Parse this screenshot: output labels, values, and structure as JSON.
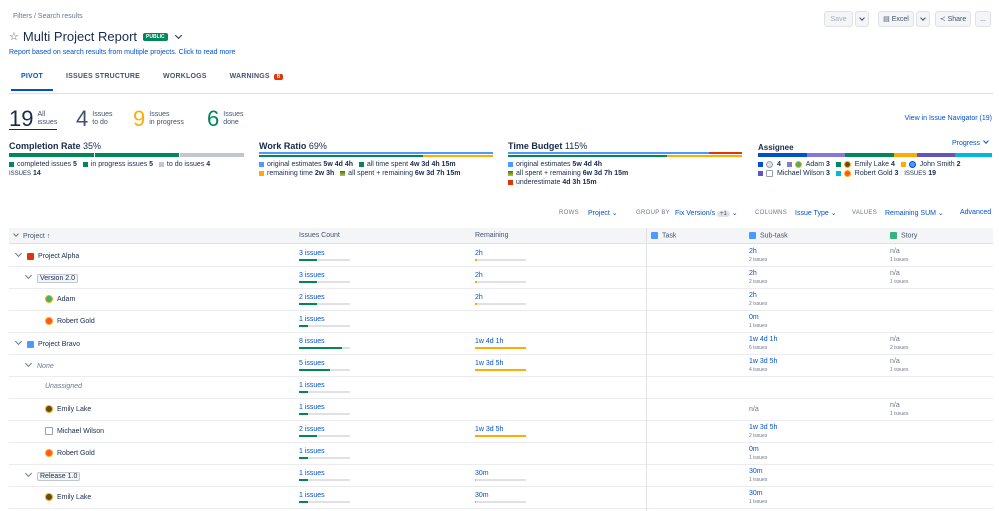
{
  "breadcrumb": {
    "part1": "Filters",
    "part2": "/ Search results"
  },
  "title": "Multi Project Report",
  "visibility_badge": "PUBLIC",
  "description_link": "Report based on search results from multiple projects. Click to read more",
  "toolbar": {
    "save": "Save",
    "excel": "Excel",
    "share": "Share",
    "more": "..."
  },
  "tabs": [
    {
      "label": "PIVOT"
    },
    {
      "label": "ISSUES STRUCTURE"
    },
    {
      "label": "WORKLOGS"
    },
    {
      "label": "WARNINGS"
    }
  ],
  "warnings_count": "6",
  "stats": [
    {
      "num": "19",
      "l1": "All",
      "l2": "issues",
      "color": "#172b4d"
    },
    {
      "num": "4",
      "l1": "Issues",
      "l2": "to do",
      "color": "#42526e"
    },
    {
      "num": "9",
      "l1": "Issues",
      "l2": "in progress",
      "color": "#ffab00"
    },
    {
      "num": "6",
      "l1": "Issues",
      "l2": "done",
      "color": "#00875a"
    }
  ],
  "view_navigator": "View in Issue Navigator (19)",
  "completion": {
    "title": "Completion Rate",
    "pct": "35%",
    "completed": "completed issues",
    "completed_n": "5",
    "inprogress": "in progress issues",
    "inprogress_n": "5",
    "todo": "to do issues",
    "todo_n": "4",
    "issues_label": "ISSUES",
    "issues_n": "14"
  },
  "work_ratio": {
    "title": "Work Ratio",
    "pct": "69%",
    "orig": "original estimates",
    "orig_v": "5w 4d 4h",
    "spent": "all time spent",
    "spent_v": "4w 3d 4h 15m",
    "remain": "remaining time",
    "remain_v": "2w 3h",
    "spent_rem": "all spent + remaining",
    "spent_rem_v": "6w 3d 7h 15m"
  },
  "time_budget": {
    "title": "Time Budget",
    "pct": "115%",
    "orig": "original estimates",
    "orig_v": "5w 4d 4h",
    "spent_rem": "all spent + remaining",
    "spent_rem_v": "6w 3d 7h 15m",
    "under": "underestimate",
    "under_v": "4d 3h 15m"
  },
  "assignee": {
    "title": "Assignee",
    "progress": "Progress",
    "a1_n": "4",
    "a2": "Adam",
    "a2_n": "3",
    "a3": "Emily Lake",
    "a3_n": "4",
    "a4": "John Smith",
    "a4_n": "2",
    "a5": "Michael Wilson",
    "a5_n": "3",
    "a6": "Robert Gold",
    "a6_n": "3",
    "issues_label": "ISSUES",
    "issues_n": "19"
  },
  "controls": {
    "rows": "ROWS",
    "rows_v": "Project",
    "group": "GROUP BY",
    "group_v": "Fix Version/s",
    "group_extra": "+1",
    "columns": "COLUMNS",
    "columns_v": "Issue Type",
    "values": "VALUES",
    "values_v": "Remaining SUM",
    "advanced": "Advanced"
  },
  "headers": {
    "project": "Project",
    "count": "Issues Count",
    "remaining": "Remaining",
    "task": "Task",
    "subtask": "Sub-task",
    "story": "Story"
  },
  "rows": [
    {
      "name": "Project Alpha",
      "count": "3 issues",
      "rem": "2h",
      "sub": "2h",
      "sub2": "2 issues",
      "story": "n/a",
      "story2": "1 issues"
    },
    {
      "name": "Version 2.0",
      "count": "3 issues",
      "rem": "2h",
      "sub": "2h",
      "sub2": "2 issues",
      "story": "n/a",
      "story2": "1 issues"
    },
    {
      "name": "Adam",
      "count": "2 issues",
      "rem": "2h",
      "sub": "2h",
      "sub2": "2 issues",
      "story": "",
      "story2": ""
    },
    {
      "name": "Robert Gold",
      "count": "1 issues",
      "rem": "",
      "sub": "0m",
      "sub2": "1 issues",
      "story": "",
      "story2": ""
    },
    {
      "name": "Project Bravo",
      "count": "8 issues",
      "rem": "1w 4d 1h",
      "sub": "1w 4d 1h",
      "sub2": "6 issues",
      "story": "n/a",
      "story2": "2 issues"
    },
    {
      "name": "None",
      "count": "5 issues",
      "rem": "1w 3d 5h",
      "sub": "1w 3d 5h",
      "sub2": "4 issues",
      "story": "n/a",
      "story2": "1 issues"
    },
    {
      "name": "Unassigned",
      "count": "1 issues",
      "rem": "",
      "sub": "",
      "sub2": "",
      "story": "",
      "story2": ""
    },
    {
      "name": "Emily Lake",
      "count": "1 issues",
      "rem": "",
      "sub": "n/a",
      "sub2": "",
      "story": "n/a",
      "story2": "1 issues"
    },
    {
      "name": "Michael Wilson",
      "count": "2 issues",
      "rem": "1w 3d 5h",
      "sub": "1w 3d 5h",
      "sub2": "2 issues",
      "story": "",
      "story2": ""
    },
    {
      "name": "Robert Gold",
      "count": "1 issues",
      "rem": "",
      "sub": "0m",
      "sub2": "1 issues",
      "story": "",
      "story2": ""
    },
    {
      "name": "Release 1.0",
      "count": "1 issues",
      "rem": "30m",
      "sub": "30m",
      "sub2": "1 issues",
      "story": "",
      "story2": ""
    },
    {
      "name": "Emily Lake",
      "count": "1 issues",
      "rem": "30m",
      "sub": "30m",
      "sub2": "1 issues",
      "story": "",
      "story2": ""
    }
  ]
}
